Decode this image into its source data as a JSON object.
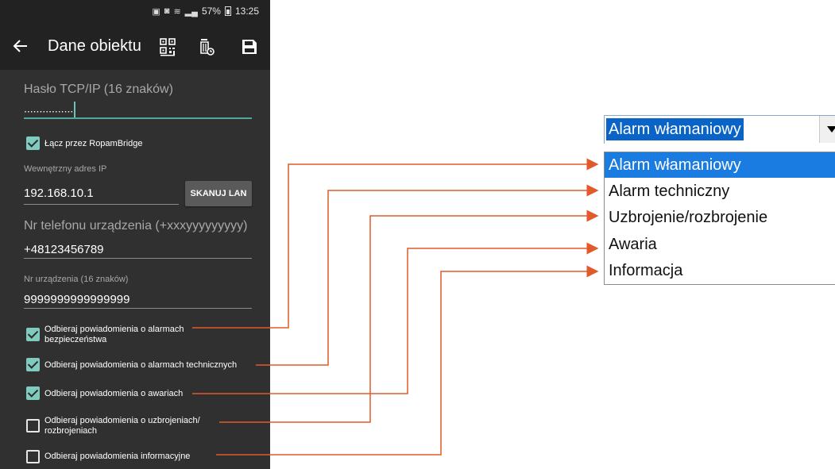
{
  "status_bar": {
    "battery": "57%",
    "time": "13:25"
  },
  "app_bar": {
    "title": "Dane obiektu"
  },
  "form": {
    "password_label": "Hasło TCP/IP (16 znaków)",
    "password_value": "................",
    "ropam_bridge_label": "Łącz przez RopamBridge",
    "ip_label": "Wewnętrzny adres IP",
    "ip_value": "192.168.10.1",
    "scan_button": "SKANUJ LAN",
    "phone_label": "Nr telefonu urządzenia (+xxxyyyyyyyyy)",
    "phone_value": "+48123456789",
    "device_label": "Nr urządzenia (16 znaków)",
    "device_value": "9999999999999999"
  },
  "notifications": [
    {
      "line1": "Odbieraj powiadomienia o alarmach",
      "line2": "bezpieczeństwa",
      "checked": true
    },
    {
      "line1": "Odbieraj powiadomienia o alarmach technicznych",
      "line2": "",
      "checked": true
    },
    {
      "line1": "Odbieraj powiadomienia o awariach",
      "line2": "",
      "checked": true
    },
    {
      "line1": "Odbieraj powiadomienia o uzbrojeniach/",
      "line2": "rozbrojeniach",
      "checked": false
    },
    {
      "line1": "Odbieraj powiadomienia informacyjne",
      "line2": "",
      "checked": false
    }
  ],
  "dropdown": {
    "selected": "Alarm włamaniowy",
    "options": [
      "Alarm włamaniowy",
      "Alarm techniczny",
      "Uzbrojenie/rozbrojenie",
      "Awaria",
      "Informacja"
    ]
  },
  "colors": {
    "accent": "#7fcbbd",
    "arrow": "#e05a2b",
    "selection": "#1a7be0"
  }
}
